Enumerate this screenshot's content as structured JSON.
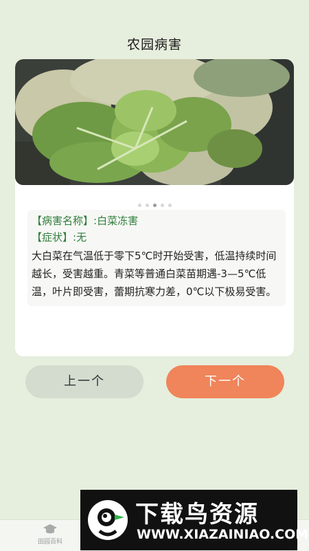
{
  "header": {
    "title": "农园病害"
  },
  "carousel": {
    "dot_count": 5,
    "active_index": 2
  },
  "disease": {
    "name_label": "【病害名称】:",
    "name_value": "白菜冻害",
    "symptom_label": "【症状】:",
    "symptom_value": "无",
    "description": "大白菜在气温低于零下5℃时开始受害，低温持续时间越长，受害越重。青菜等普通白菜苗期遇-3—5℃低温，叶片即受害，蕾期抗寒力差，0℃以下极易受害。"
  },
  "buttons": {
    "prev_label": "上一个",
    "next_label": "下一个"
  },
  "tabbar": {
    "tab1_label": "田园百科"
  },
  "watermark": {
    "title": "下载鸟资源",
    "url": "WWW.XIAZAINIAO.COM"
  },
  "colors": {
    "accent": "#f0845a",
    "label_green": "#2f7d3a",
    "background": "#e6eedd"
  }
}
